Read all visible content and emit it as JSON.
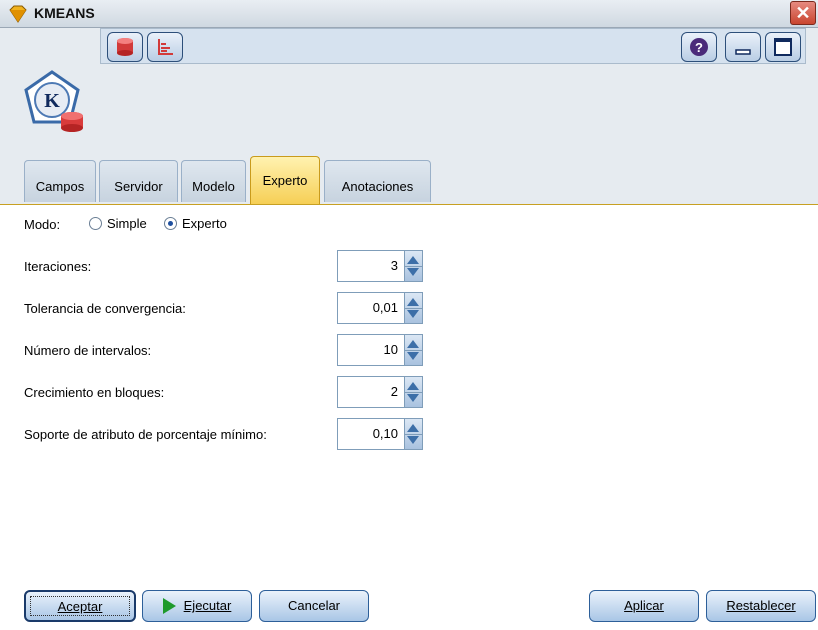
{
  "window": {
    "title": "KMEANS",
    "close_glyph": "✕"
  },
  "header": {
    "node_icon_letter": "K",
    "toolbar_buttons": [
      "database-icon",
      "chart-icon"
    ],
    "right_buttons": [
      "help-icon",
      "minimize-icon",
      "maximize-icon"
    ],
    "help_glyph": "?"
  },
  "tabs": [
    {
      "label": "Campos",
      "active": false
    },
    {
      "label": "Servidor",
      "active": false
    },
    {
      "label": "Modelo",
      "active": false
    },
    {
      "label": "Experto",
      "active": true
    },
    {
      "label": "Anotaciones",
      "active": false
    }
  ],
  "mode": {
    "label": "Modo:",
    "options": [
      {
        "label": "Simple",
        "selected": false
      },
      {
        "label": "Experto",
        "selected": true
      }
    ]
  },
  "fields": [
    {
      "label": "Iteraciones:",
      "value": "3"
    },
    {
      "label": "Tolerancia de convergencia:",
      "value": "0,01"
    },
    {
      "label": "Número de intervalos:",
      "value": "10"
    },
    {
      "label": "Crecimiento en bloques:",
      "value": "2"
    },
    {
      "label": "Soporte de atributo de porcentaje mínimo:",
      "value": "0,10"
    }
  ],
  "buttons": {
    "ok": "Aceptar",
    "run": "Ejecutar",
    "cancel": "Cancelar",
    "apply": "Aplicar",
    "reset": "Restablecer"
  },
  "colors": {
    "active_tab": "#f6cf55",
    "accent": "#2d5f99",
    "run_icon": "#1e9a2c"
  }
}
